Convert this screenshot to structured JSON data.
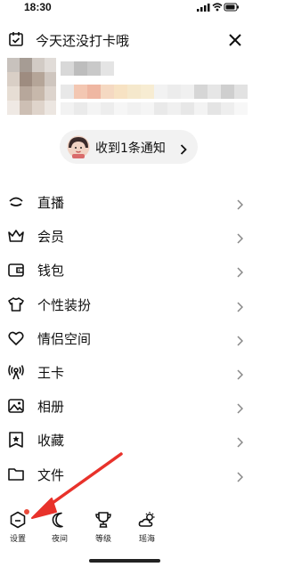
{
  "status_bar": {
    "time": "18:30"
  },
  "checkin": {
    "text": "今天还没打卡哦"
  },
  "notification": {
    "text": "收到1条通知"
  },
  "menu": {
    "items": [
      {
        "label": "直播",
        "icon": "live-icon"
      },
      {
        "label": "会员",
        "icon": "crown-icon"
      },
      {
        "label": "钱包",
        "icon": "wallet-icon"
      },
      {
        "label": "个性装扮",
        "icon": "tshirt-icon"
      },
      {
        "label": "情侣空间",
        "icon": "heart-icon"
      },
      {
        "label": "王卡",
        "icon": "signal-icon"
      },
      {
        "label": "相册",
        "icon": "photo-icon"
      },
      {
        "label": "收藏",
        "icon": "bookmark-star-icon"
      },
      {
        "label": "文件",
        "icon": "folder-icon"
      }
    ]
  },
  "bottom_bar": {
    "settings": "设置",
    "night": "夜间",
    "level": "等级",
    "weather": "瑶海"
  },
  "colors": {
    "badge": "#e94b3c",
    "arrow": "#e8322b",
    "pill_bg": "#f2f2f2"
  }
}
